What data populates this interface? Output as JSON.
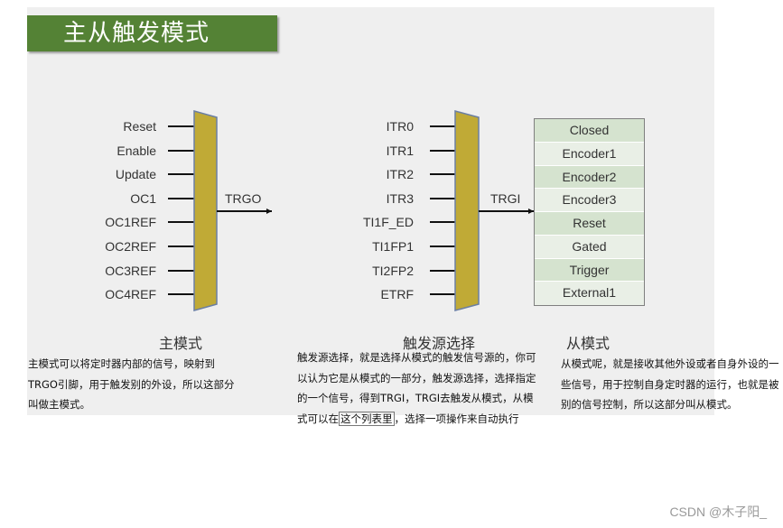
{
  "title": "主从触发模式",
  "master": {
    "inputs": [
      "Reset",
      "Enable",
      "Update",
      "OC1",
      "OC1REF",
      "OC2REF",
      "OC3REF",
      "OC4REF"
    ],
    "output": "TRGO",
    "section_title": "主模式",
    "description": "主模式可以将定时器内部的信号，映射到TRGO引脚，用于触发别的外设，所以这部分叫做主模式。"
  },
  "trigger_source": {
    "inputs": [
      "ITR0",
      "ITR1",
      "ITR2",
      "ITR3",
      "TI1F_ED",
      "TI1FP1",
      "TI2FP2",
      "ETRF"
    ],
    "output": "TRGI",
    "section_title": "触发源选择",
    "description_before": "触发源选择，就是选择从模式的触发信号源的，你可以认为它是从模式的一部分，触发源选择，选择指定的一个信号，得到TRGI，TRGI去触发从模式，从模式可以在",
    "description_highlight": "这个列表里",
    "description_after": "，选择一项操作来自动执行"
  },
  "slave": {
    "modes": [
      "Closed",
      "Encoder1",
      "Encoder2",
      "Encoder3",
      "Reset",
      "Gated",
      "Trigger",
      "External1"
    ],
    "section_title": "从模式",
    "description": "从模式呢，就是接收其他外设或者自身外设的一些信号，用于控制自身定时器的运行，也就是被别的信号控制，所以这部分叫从模式。"
  },
  "watermark": "CSDN @木子阳_",
  "colors": {
    "title_bg": "#548235",
    "mux_fill": "#c0aa36",
    "mux_border": "#6b7fa3",
    "list_row_dark": "#d5e3cf",
    "list_row_light": "#e9efe6",
    "slide_bg": "#efefef"
  }
}
